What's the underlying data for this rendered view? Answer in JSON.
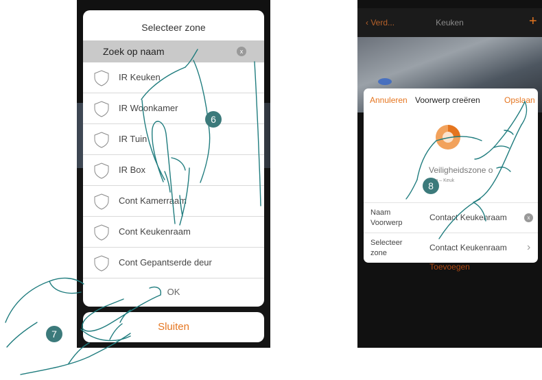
{
  "left_phone": {
    "dialog_title": "Selecteer zone",
    "search_placeholder": "Zoek op naam",
    "clear_icon": "x",
    "zones": [
      {
        "label": "IR Keuken"
      },
      {
        "label": "IR Woonkamer"
      },
      {
        "label": "IR Tuin"
      },
      {
        "label": "IR Box"
      },
      {
        "label": "Cont Kamerraam"
      },
      {
        "label": "Cont Keukenraam"
      },
      {
        "label": "Cont Gepantserde deur"
      }
    ],
    "ok_label": "OK",
    "close_label": "Sluiten"
  },
  "right_phone": {
    "back_label": "Verd...",
    "title": "Keuken",
    "add_icon": "+",
    "card": {
      "cancel_label": "Annuleren",
      "title": "Voorwerp creëren",
      "save_label": "Opslaan",
      "object_name": "Veiligheidszone o",
      "object_sub": "Bega        – Keuk",
      "name_row": {
        "label": "Naam Voorwerp",
        "value": "Contact Keukenraam",
        "clear_icon": "x"
      },
      "zone_row": {
        "label": "Selecteer zone",
        "value": "Contact Keukenraam",
        "chevron": "›"
      }
    },
    "background_text": "Toevoegen"
  },
  "steps": {
    "step6": "6",
    "step7": "7",
    "step8": "8"
  },
  "colors": {
    "accent": "#e5751f",
    "badge": "#3c7a7b",
    "hand_stroke": "#1f7c7e"
  }
}
